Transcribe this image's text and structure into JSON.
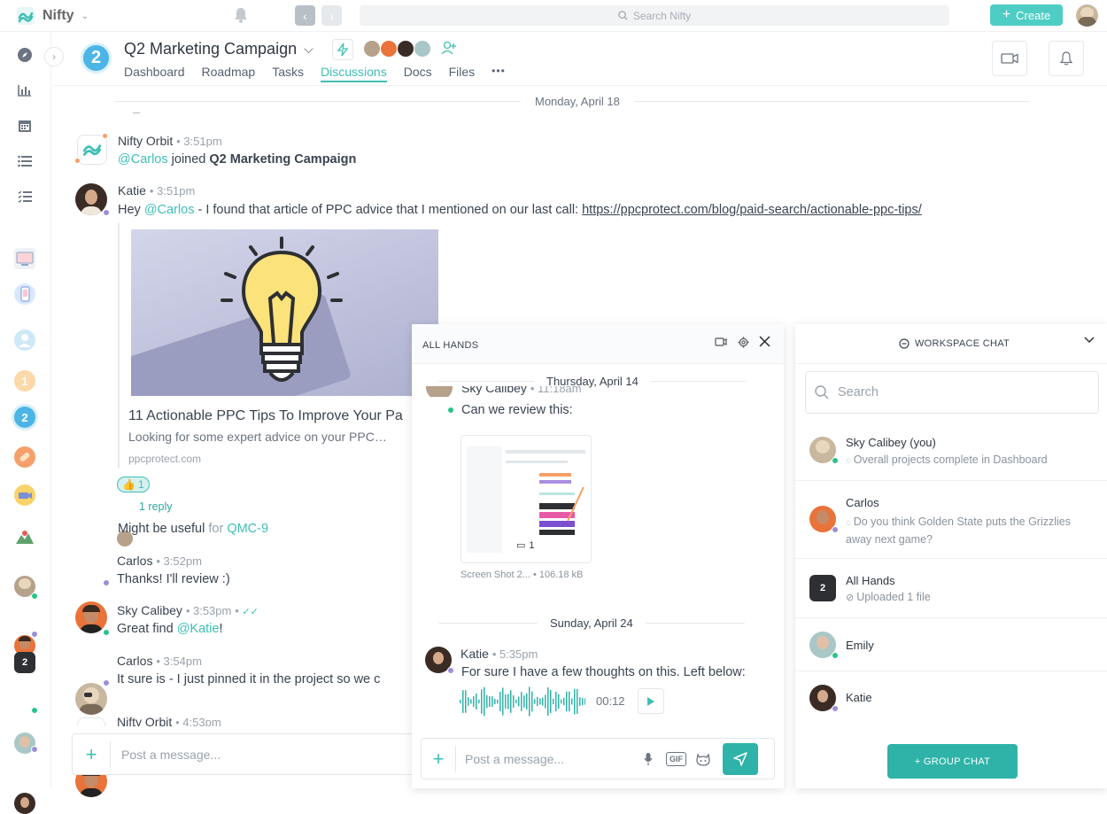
{
  "app": {
    "name": "Nifty",
    "search_placeholder": "Search Nifty",
    "create_label": "Create"
  },
  "project": {
    "number": "2",
    "title": "Q2 Marketing Campaign",
    "tabs": [
      "Dashboard",
      "Roadmap",
      "Tasks",
      "Discussions",
      "Docs",
      "Files"
    ],
    "active_tab": "Discussions",
    "more": "•••"
  },
  "rail": {
    "badges": [
      "1",
      "2"
    ],
    "square_badge": "2"
  },
  "discussion": {
    "date": "Monday, April 18",
    "messages": [
      {
        "name": "Nifty Orbit",
        "time": "3:51pm",
        "mention": "@Carlos",
        "text": " joined ",
        "bold": "Q2 Marketing Campaign"
      },
      {
        "name": "Katie",
        "time": "3:51pm",
        "pre": "Hey ",
        "mention": "@Carlos",
        "text": " - I found that article of PPC advice that I mentioned on our last call: ",
        "link": "https://ppcprotect.com/blog/paid-search/actionable-ppc-tips/"
      },
      {
        "name": "Carlos",
        "time": "3:52pm",
        "text": "Thanks! I'll review :)"
      },
      {
        "name": "Sky Calibey",
        "time": "3:53pm",
        "pre": "Great find ",
        "mention": "@Katie",
        "post": "!"
      },
      {
        "name": "Carlos",
        "time": "3:54pm",
        "text": "It sure is - I just pinned it in the project so we c"
      },
      {
        "name": "Nifty Orbit",
        "time": "4:53pm"
      }
    ],
    "preview": {
      "title": "11 Actionable PPC Tips To Improve Your Pa",
      "desc": "Looking for some expert advice on your PPC…",
      "domain": "ppcprotect.com"
    },
    "reaction_count": "1",
    "reply_label": "1 reply",
    "useful_text": "Might be useful ",
    "useful_for": "for ",
    "useful_task": "QMC-9",
    "composer_placeholder": "Post a message..."
  },
  "all_hands": {
    "title": "ALL HANDS",
    "date1": "Thursday, April 14",
    "partial_name": "Sky Calibey",
    "partial_time": "11:18am",
    "review_text": "Can we review this:",
    "file_name": "Screen Shot 2...",
    "file_size": "• 106.18 kB",
    "file_comments": "1",
    "date2": "Sunday, April 24",
    "katie_name": "Katie",
    "katie_time": "5:35pm",
    "katie_text": "For sure I have a few thoughts on this. Left below:",
    "audio_duration": "00:12",
    "composer_placeholder": "Post a message...",
    "gif_label": "GIF"
  },
  "workspace_chat": {
    "title": "WORKSPACE CHAT",
    "search_placeholder": "Search",
    "items": [
      {
        "name": "Sky Calibey (you)",
        "sub": "Overall projects complete in Dashboard"
      },
      {
        "name": "Carlos",
        "sub": "Do you think Golden State puts the Grizzlies away next game?"
      },
      {
        "name": "All Hands",
        "sub": "Uploaded 1 file",
        "badge": "2"
      },
      {
        "name": "Emily",
        "sub": ""
      },
      {
        "name": "Katie",
        "sub": ""
      }
    ],
    "group_chat_label": "+ GROUP CHAT"
  }
}
